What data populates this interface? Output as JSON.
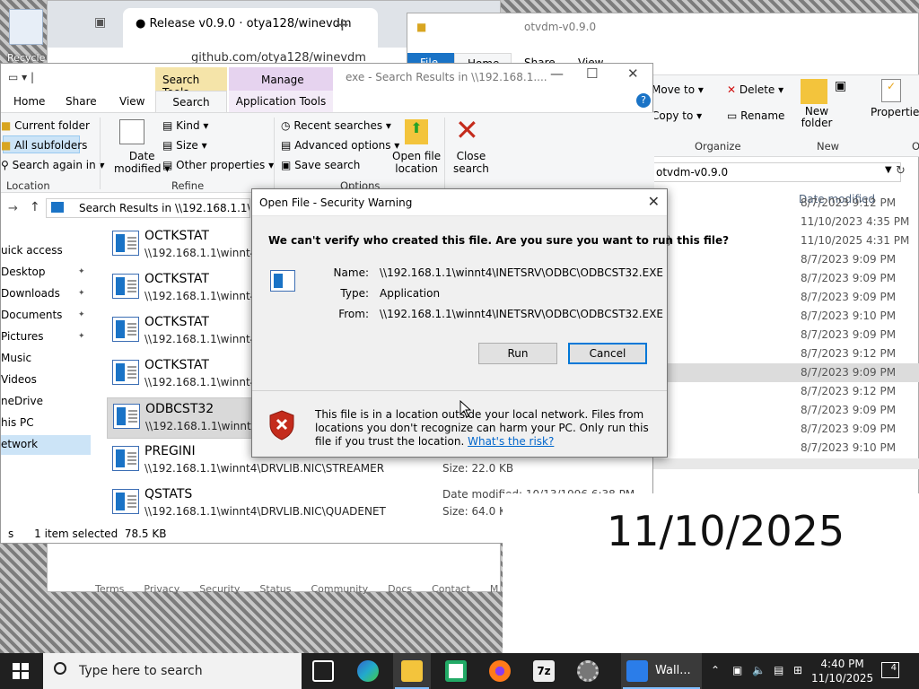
{
  "desktop": {
    "recycle_label": "Recycle",
    "big_date": "11/10/2025"
  },
  "browser": {
    "tab_title": "Release v0.9.0 · otya128/winevdm",
    "url": "github.com/otya128/winevdm",
    "footer_links": [
      "Terms",
      "Privacy",
      "Security",
      "Status",
      "Community",
      "Docs",
      "Contact",
      "M"
    ]
  },
  "otvdm": {
    "title": "otvdm-v0.9.0",
    "tabs": [
      "File",
      "Home",
      "Share",
      "View"
    ],
    "ribbon": {
      "move_to": "Move to",
      "copy_to": "Copy to",
      "delete": "Delete",
      "rename": "Rename",
      "new_folder": "New folder",
      "properties": "Properties",
      "organize": "Organize",
      "new": "New",
      "open_group": "O"
    },
    "address": "otvdm-v0.9.0",
    "col_date": "Date modified",
    "dates": [
      "8/7/2023 9:12 PM",
      "11/10/2023 4:35 PM",
      "11/10/2025 4:31 PM",
      "8/7/2023 9:09 PM",
      "8/7/2023 9:09 PM",
      "8/7/2023 9:09 PM",
      "8/7/2023 9:10 PM",
      "8/7/2023 9:09 PM",
      "8/7/2023 9:12 PM",
      "8/7/2023 9:09 PM",
      "8/7/2023 9:12 PM",
      "8/7/2023 9:09 PM",
      "8/7/2023 9:09 PM",
      "8/7/2023 9:10 PM"
    ],
    "selected_index": 9,
    "partial_e": "e)"
  },
  "explorer": {
    "title": "exe - Search Results in \\\\192.168.1....",
    "ctx_search_tools": "Search Tools",
    "ctx_manage": "Manage",
    "tabs": {
      "home": "Home",
      "share": "Share",
      "view": "View",
      "search": "Search",
      "app_tools": "Application Tools"
    },
    "ribbon": {
      "current_folder": "Current folder",
      "all_subfolders": "All subfolders",
      "search_again_in": "Search again in",
      "location": "Location",
      "date_modified_1": "Date",
      "date_modified_2": "modified",
      "kind": "Kind",
      "size": "Size",
      "other_properties": "Other properties",
      "refine": "Refine",
      "recent_searches": "Recent searches",
      "advanced_options": "Advanced options",
      "save_search": "Save search",
      "open_file_location_1": "Open file",
      "open_file_location_2": "location",
      "close_search_1": "Close",
      "close_search_2": "search",
      "options": "Options"
    },
    "address": "Search Results in \\\\192.168.1.1\\winnt4",
    "nav": [
      "uick access",
      "Desktop",
      "Downloads",
      "Documents",
      "Pictures",
      "Music",
      "Videos",
      "neDrive",
      "his PC",
      "etwork"
    ],
    "items": [
      {
        "name": "OCTKSTAT",
        "path": "\\\\192.168.1.1\\winnt4\\D",
        "meta1": "",
        "meta2": ""
      },
      {
        "name": "OCTKSTAT",
        "path": "\\\\192.168.1.1\\winnt4\\D",
        "meta1": "",
        "meta2": ""
      },
      {
        "name": "OCTKSTAT",
        "path": "\\\\192.168.1.1\\winnt4\\D",
        "meta1": "",
        "meta2": ""
      },
      {
        "name": "OCTKSTAT",
        "path": "\\\\192.168.1.1\\winnt4\\D",
        "meta1": "",
        "meta2": ""
      },
      {
        "name": "ODBCST32",
        "path": "\\\\192.168.1.1\\winnt4\\IN",
        "meta1": "",
        "meta2": ""
      },
      {
        "name": "PREGINI",
        "path": "\\\\192.168.1.1\\winnt4\\DRVLIB.NIC\\STREAMER",
        "meta1": "Date modified: 10/13/1996 6:38 PM",
        "meta2": "Size: 22.0 KB"
      },
      {
        "name": "QSTATS",
        "path": "\\\\192.168.1.1\\winnt4\\DRVLIB.NIC\\QUADENET",
        "meta1": "Date modified: 10/13/1996 6:38 PM",
        "meta2": "Size: 64.0 KB"
      }
    ],
    "selected_item": 4,
    "status": {
      "left": "s",
      "selected": "1 item selected",
      "size": "78.5 KB"
    }
  },
  "dialog": {
    "title": "Open File - Security Warning",
    "question": "We can't verify who created this file. Are you sure you want to run this file?",
    "name_label": "Name:",
    "name_value": "\\\\192.168.1.1\\winnt4\\INETSRV\\ODBC\\ODBCST32.EXE",
    "type_label": "Type:",
    "type_value": "Application",
    "from_label": "From:",
    "from_value": "\\\\192.168.1.1\\winnt4\\INETSRV\\ODBC\\ODBCST32.EXE",
    "run_label": "Run",
    "cancel_label": "Cancel",
    "warning_text": "This file is in a location outside your local network. Files from locations you don't recognize can harm your PC. Only run this file if you trust the location.",
    "risk_link": "What's the risk?"
  },
  "taskbar": {
    "search_placeholder": "Type here to search",
    "wall_label": "Wall...",
    "time": "4:40 PM",
    "date": "11/10/2025",
    "notification_count": "4"
  }
}
